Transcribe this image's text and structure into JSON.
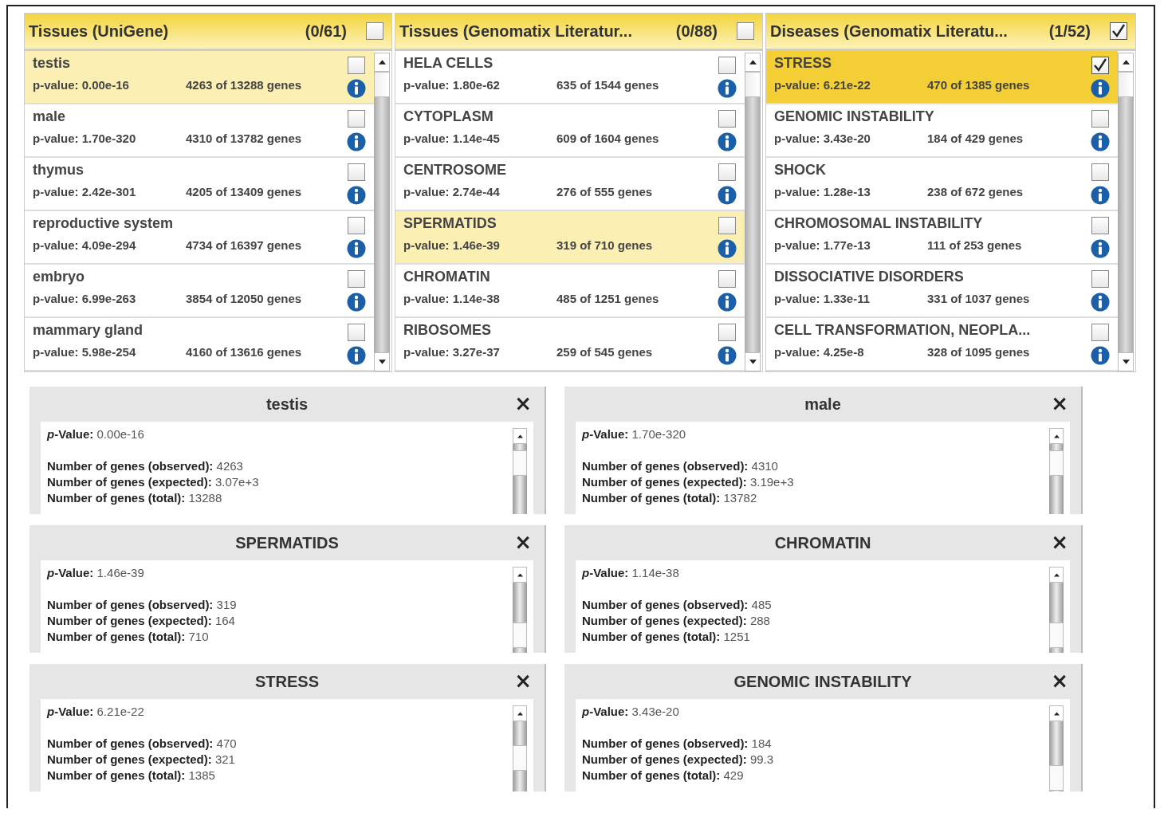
{
  "panels": [
    {
      "title": "Tissues (UniGene)",
      "count": "(0/61)",
      "checked": false,
      "rows": [
        {
          "name": "testis",
          "pvalue": "p-value: 0.00e-16",
          "genes": "4263 of 13288 genes",
          "selected": true,
          "checked": false
        },
        {
          "name": "male",
          "pvalue": "p-value: 1.70e-320",
          "genes": "4310 of 13782 genes",
          "selected": false,
          "checked": false
        },
        {
          "name": "thymus",
          "pvalue": "p-value: 2.42e-301",
          "genes": "4205 of 13409 genes",
          "selected": false,
          "checked": false
        },
        {
          "name": "reproductive system",
          "pvalue": "p-value: 4.09e-294",
          "genes": "4734 of 16397 genes",
          "selected": false,
          "checked": false
        },
        {
          "name": "embryo",
          "pvalue": "p-value: 6.99e-263",
          "genes": "3854 of 12050 genes",
          "selected": false,
          "checked": false
        },
        {
          "name": "mammary gland",
          "pvalue": "p-value: 5.98e-254",
          "genes": "4160 of 13616 genes",
          "selected": false,
          "checked": false
        }
      ]
    },
    {
      "title": "Tissues (Genomatix Literatur...",
      "count": "(0/88)",
      "checked": false,
      "rows": [
        {
          "name": "HELA CELLS",
          "pvalue": "p-value: 1.80e-62",
          "genes": "635 of 1544 genes",
          "selected": false,
          "checked": false
        },
        {
          "name": "CYTOPLASM",
          "pvalue": "p-value: 1.14e-45",
          "genes": "609 of 1604 genes",
          "selected": false,
          "checked": false
        },
        {
          "name": "CENTROSOME",
          "pvalue": "p-value: 2.74e-44",
          "genes": "276 of 555 genes",
          "selected": false,
          "checked": false
        },
        {
          "name": "SPERMATIDS",
          "pvalue": "p-value: 1.46e-39",
          "genes": "319 of 710 genes",
          "selected": true,
          "checked": false
        },
        {
          "name": "CHROMATIN",
          "pvalue": "p-value: 1.14e-38",
          "genes": "485 of 1251 genes",
          "selected": false,
          "checked": false
        },
        {
          "name": "RIBOSOMES",
          "pvalue": "p-value: 3.27e-37",
          "genes": "259 of 545 genes",
          "selected": false,
          "checked": false
        }
      ]
    },
    {
      "title": "Diseases (Genomatix Literatu...",
      "count": "(1/52)",
      "checked": true,
      "rows": [
        {
          "name": "STRESS",
          "pvalue": "p-value: 6.21e-22",
          "genes": "470 of 1385 genes",
          "selected": true,
          "checked": true
        },
        {
          "name": "GENOMIC INSTABILITY",
          "pvalue": "p-value: 3.43e-20",
          "genes": "184 of 429 genes",
          "selected": false,
          "checked": false
        },
        {
          "name": "SHOCK",
          "pvalue": "p-value: 1.28e-13",
          "genes": "238 of 672 genes",
          "selected": false,
          "checked": false
        },
        {
          "name": "CHROMOSOMAL INSTABILITY",
          "pvalue": "p-value: 1.77e-13",
          "genes": "111 of 253 genes",
          "selected": false,
          "checked": false
        },
        {
          "name": "DISSOCIATIVE DISORDERS",
          "pvalue": "p-value: 1.33e-11",
          "genes": "331 of 1037 genes",
          "selected": false,
          "checked": false
        },
        {
          "name": "CELL TRANSFORMATION, NEOPLA...",
          "pvalue": "p-value: 4.25e-8",
          "genes": "328 of 1095 genes",
          "selected": false,
          "checked": false
        }
      ]
    }
  ],
  "popups": [
    {
      "title": "testis",
      "close": "×",
      "lines": [
        {
          "label": "*p*-Value:",
          "value": "0.00e-16"
        },
        {
          "label": "Number of genes (observed):",
          "value": "4263"
        },
        {
          "label": "Number of genes (expected):",
          "value": "3.07e+3"
        },
        {
          "label": "Number of genes (total):",
          "value": "13288"
        }
      ]
    },
    {
      "title": "male",
      "close": "×",
      "lines": [
        {
          "label": "*p*-Value:",
          "value": "1.70e-320"
        },
        {
          "label": "Number of genes (observed):",
          "value": "4310"
        },
        {
          "label": "Number of genes (expected):",
          "value": "3.19e+3"
        },
        {
          "label": "Number of genes (total):",
          "value": "13782"
        }
      ]
    },
    {
      "title": "SPERMATIDS",
      "close": "×",
      "lines": [
        {
          "label": "*p*-Value:",
          "value": "1.46e-39"
        },
        {
          "label": "Number of genes (observed):",
          "value": "319"
        },
        {
          "label": "Number of genes (expected):",
          "value": "164"
        },
        {
          "label": "Number of genes (total):",
          "value": "710"
        }
      ]
    },
    {
      "title": "CHROMATIN",
      "close": "×",
      "lines": [
        {
          "label": "*p*-Value:",
          "value": "1.14e-38"
        },
        {
          "label": "Number of genes (observed):",
          "value": "485"
        },
        {
          "label": "Number of genes (expected):",
          "value": "288"
        },
        {
          "label": "Number of genes (total):",
          "value": "1251"
        }
      ]
    },
    {
      "title": "STRESS",
      "close": "×",
      "lines": [
        {
          "label": "*p*-Value:",
          "value": "6.21e-22"
        },
        {
          "label": "Number of genes (observed):",
          "value": "470"
        },
        {
          "label": "Number of genes (expected):",
          "value": "321"
        },
        {
          "label": "Number of genes (total):",
          "value": "1385"
        }
      ]
    },
    {
      "title": "GENOMIC INSTABILITY",
      "close": "×",
      "lines": [
        {
          "label": "*p*-Value:",
          "value": "3.43e-20"
        },
        {
          "label": "Number of genes (observed):",
          "value": "184"
        },
        {
          "label": "Number of genes (expected):",
          "value": "99.3"
        },
        {
          "label": "Number of genes (total):",
          "value": "429"
        }
      ]
    }
  ]
}
